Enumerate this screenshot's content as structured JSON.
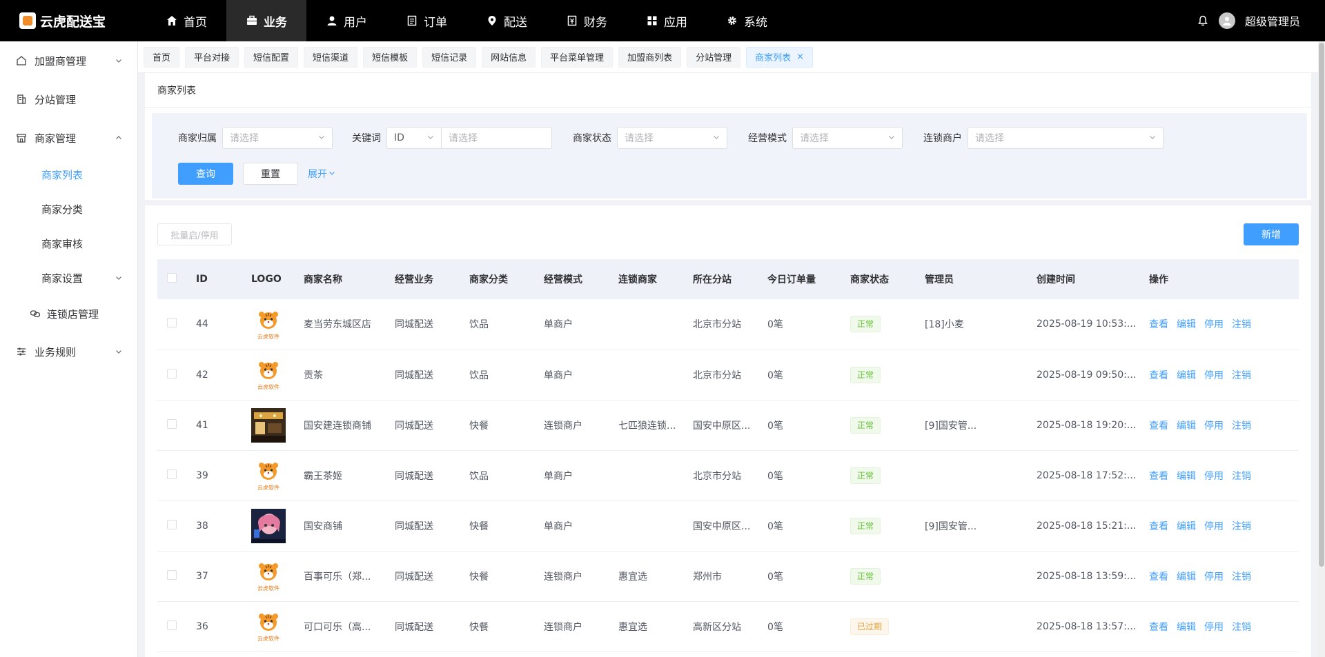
{
  "brand": {
    "name": "云虎配送宝"
  },
  "topnav": [
    {
      "label": "首页",
      "icon": "home-icon"
    },
    {
      "label": "业务",
      "icon": "briefcase-icon",
      "active": true
    },
    {
      "label": "用户",
      "icon": "user-icon"
    },
    {
      "label": "订单",
      "icon": "order-icon"
    },
    {
      "label": "配送",
      "icon": "location-icon"
    },
    {
      "label": "财务",
      "icon": "finance-icon"
    },
    {
      "label": "应用",
      "icon": "apps-icon"
    },
    {
      "label": "系统",
      "icon": "gear-icon"
    }
  ],
  "user": {
    "name": "超级管理员"
  },
  "sidebar": {
    "items": [
      {
        "label": "加盟商管理"
      },
      {
        "label": "分站管理"
      },
      {
        "label": "商家管理"
      },
      {
        "label": "业务规则"
      }
    ],
    "sub": [
      {
        "label": "商家列表"
      },
      {
        "label": "商家分类"
      },
      {
        "label": "商家审核"
      },
      {
        "label": "商家设置"
      }
    ],
    "chain": {
      "label": "连锁店管理"
    }
  },
  "tags": [
    "首页",
    "平台对接",
    "短信配置",
    "短信渠道",
    "短信模板",
    "短信记录",
    "网站信息",
    "平台菜单管理",
    "加盟商列表",
    "分站管理",
    "商家列表"
  ],
  "page": {
    "title": "商家列表"
  },
  "filter": {
    "owner_label": "商家归属",
    "owner_placeholder": "请选择",
    "keyword_label": "关键词",
    "keyword_type": "ID",
    "keyword_placeholder": "请选择",
    "status_label": "商家状态",
    "status_placeholder": "请选择",
    "mode_label": "经营模式",
    "mode_placeholder": "请选择",
    "chain_label": "连锁商户",
    "chain_placeholder": "请选择",
    "query": "查询",
    "reset": "重置",
    "expand": "展开"
  },
  "toolbar": {
    "batch": "批量启/停用",
    "add": "新增"
  },
  "table": {
    "headers": [
      "ID",
      "LOGO",
      "商家名称",
      "经营业务",
      "商家分类",
      "经营模式",
      "连锁商家",
      "所在分站",
      "今日订单量",
      "商家状态",
      "管理员",
      "创建时间",
      "操作"
    ],
    "ops": [
      "查看",
      "编辑",
      "停用",
      "注销"
    ],
    "logo_text": "云虎软件",
    "rows": [
      {
        "id": "44",
        "logo": "tiger",
        "name": "麦当劳东城区店",
        "biz": "同城配送",
        "cat": "饮品",
        "mode": "单商户",
        "chain": "",
        "station": "北京市分站",
        "orders": "0笔",
        "status": "正常",
        "status_type": "ok",
        "admin": "[18]小麦",
        "created": "2025-08-19 10:53:..."
      },
      {
        "id": "42",
        "logo": "tiger",
        "name": "贡茶",
        "biz": "同城配送",
        "cat": "饮品",
        "mode": "单商户",
        "chain": "",
        "station": "北京市分站",
        "orders": "0笔",
        "status": "正常",
        "status_type": "ok",
        "admin": "",
        "created": "2025-08-19 09:50:..."
      },
      {
        "id": "41",
        "logo": "shop",
        "name": "国安建连锁商铺",
        "biz": "同城配送",
        "cat": "快餐",
        "mode": "连锁商户",
        "chain": "七匹狼连锁...",
        "station": "国安中原区...",
        "orders": "0笔",
        "status": "正常",
        "status_type": "ok",
        "admin": "[9]国安管...",
        "created": "2025-08-18 19:20:..."
      },
      {
        "id": "39",
        "logo": "tiger",
        "name": "霸王茶姬",
        "biz": "同城配送",
        "cat": "饮品",
        "mode": "单商户",
        "chain": "",
        "station": "北京市分站",
        "orders": "0笔",
        "status": "正常",
        "status_type": "ok",
        "admin": "",
        "created": "2025-08-18 17:52:..."
      },
      {
        "id": "38",
        "logo": "doll",
        "name": "国安商铺",
        "biz": "同城配送",
        "cat": "快餐",
        "mode": "单商户",
        "chain": "",
        "station": "国安中原区...",
        "orders": "0笔",
        "status": "正常",
        "status_type": "ok",
        "admin": "[9]国安管...",
        "created": "2025-08-18 15:21:..."
      },
      {
        "id": "37",
        "logo": "tiger",
        "name": "百事可乐（郑...",
        "biz": "同城配送",
        "cat": "快餐",
        "mode": "连锁商户",
        "chain": "惠宜选",
        "station": "郑州市",
        "orders": "0笔",
        "status": "正常",
        "status_type": "ok",
        "admin": "",
        "created": "2025-08-18 13:59:..."
      },
      {
        "id": "36",
        "logo": "tiger",
        "name": "可口可乐（高...",
        "biz": "同城配送",
        "cat": "快餐",
        "mode": "连锁商户",
        "chain": "惠宜选",
        "station": "高新区分站",
        "orders": "0笔",
        "status": "已过期",
        "status_type": "exp",
        "admin": "",
        "created": "2025-08-18 13:57:..."
      }
    ]
  },
  "colors": {
    "accent": "#409eff",
    "topbar": "#000000",
    "ok": "#67c23a",
    "expired": "#e6a23c"
  }
}
